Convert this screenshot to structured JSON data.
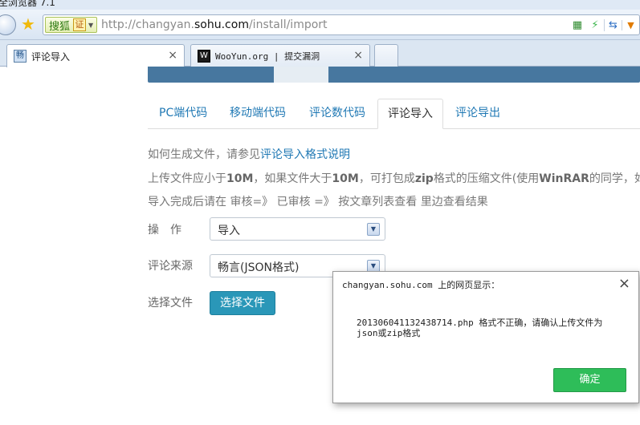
{
  "browser": {
    "title_fragment": "全浏览器 7.1",
    "address": {
      "sohu_badge": "搜狐",
      "cert_badge": "证",
      "url_prefix": "http://changyan.",
      "url_domain": "sohu.com",
      "url_path": "/install/import"
    },
    "tabs": [
      {
        "label": "评论导入",
        "close": "×"
      },
      {
        "label": "WooYun.org | 提交漏洞",
        "close": "×"
      }
    ]
  },
  "page": {
    "subtabs": [
      "PC端代码",
      "移动端代码",
      "评论数代码",
      "评论导入",
      "评论导出"
    ],
    "active_subtab": "评论导入",
    "info": {
      "line1_prefix": "如何生成文件，请参见",
      "line1_link": "评论导入格式说明",
      "line2_a": "上传文件应小于",
      "line2_b": "10M",
      "line2_c": "，如果文件大于",
      "line2_d": "10M",
      "line2_e": "，可打包成",
      "line2_f": "zip",
      "line2_g": "格式的压缩文件(使用",
      "line2_h": "WinRAR",
      "line2_i": "的同学，如何打",
      "line3": "导入完成后请在 审核=》 已审核 =》 按文章列表查看 里边查看结果"
    },
    "form": {
      "operation_label": "操　作",
      "operation_value": "导入",
      "source_label": "评论来源",
      "source_value": "畅言(JSON格式)",
      "file_label": "选择文件",
      "file_button": "选择文件"
    }
  },
  "dialog": {
    "title": "changyan.sohu.com 上的网页显示：",
    "close": "×",
    "message": "201306041132438714.php 格式不正确，请确认上传文件为json或zip格式",
    "ok_button": "确定"
  }
}
